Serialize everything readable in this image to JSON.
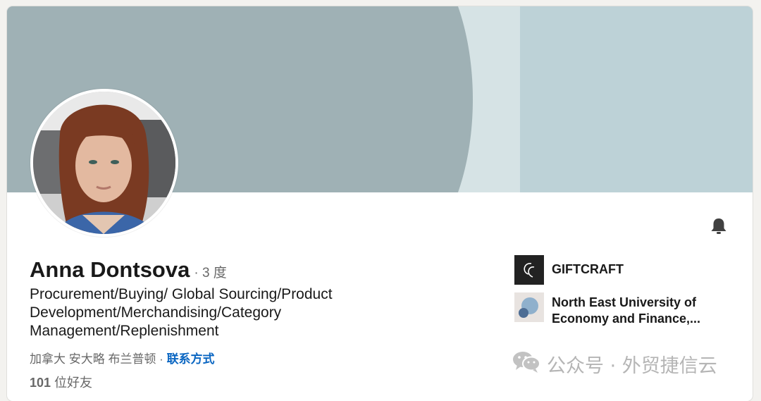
{
  "profile": {
    "name": "Anna Dontsova",
    "degree": "· 3 度",
    "headline_lines": [
      "Procurement/Buying/ Global Sourcing/Product",
      "Development/Merchandising/Category",
      "Management/Replenishment"
    ],
    "location": "加拿大 安大略 布兰普顿 · ",
    "contact_label": "联系方式",
    "connections_count": "101",
    "connections_label": " 位好友"
  },
  "companies": [
    {
      "name": "GIFTCRAFT",
      "logo": "giftcraft-logo"
    },
    {
      "name_lines": [
        "North East University of",
        "Economy and Finance,..."
      ],
      "logo": "university-logo"
    }
  ],
  "icons": {
    "bell": "bell-icon"
  },
  "watermark": {
    "text": "公众号 · 外贸捷信云",
    "logo": "wechat-logo"
  },
  "colors": {
    "link": "#0a66c2",
    "banner_dark": "#9fb1b5",
    "banner_light": "#bdd2d7",
    "banner_gap": "#d6e3e5"
  }
}
